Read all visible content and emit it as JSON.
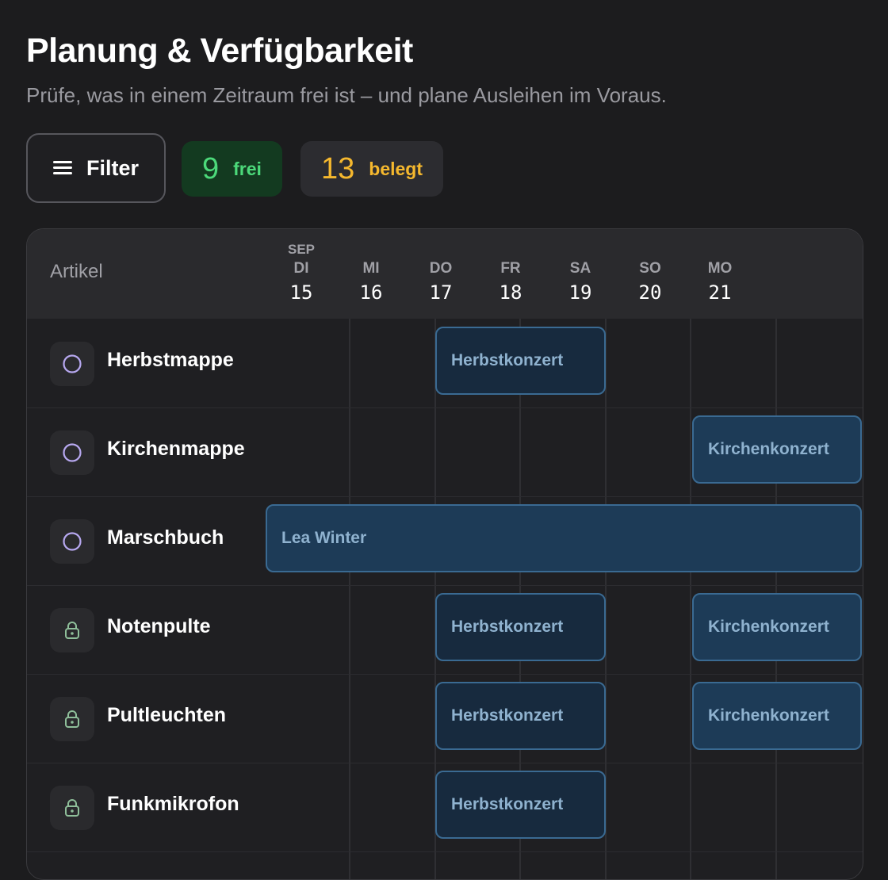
{
  "header": {
    "title": "Planung & Verfügbarkeit",
    "subtitle": "Prüfe, was in einem Zeitraum frei ist – und plane Ausleihen im Voraus."
  },
  "toolbar": {
    "filter_label": "Filter",
    "free_count": "9",
    "free_label": "frei",
    "busy_count": "13",
    "busy_label": "belegt"
  },
  "colors": {
    "accent_free": "#4cd97a",
    "accent_busy": "#f5b82e",
    "booking_border": "#3a6a92",
    "circle_icon": "#b7a8f0",
    "lock_icon": "#8fbf9a"
  },
  "grid": {
    "column_label": "Artikel",
    "month": "SEP",
    "days": [
      {
        "dow": "DI",
        "num": "15"
      },
      {
        "dow": "MI",
        "num": "16"
      },
      {
        "dow": "DO",
        "num": "17"
      },
      {
        "dow": "FR",
        "num": "18"
      },
      {
        "dow": "SA",
        "num": "19"
      },
      {
        "dow": "SO",
        "num": "20"
      },
      {
        "dow": "MO",
        "num": "21"
      }
    ],
    "rows": [
      {
        "name": "Herbstmappe",
        "icon": "circle-icon"
      },
      {
        "name": "Kirchenmappe",
        "icon": "circle-icon"
      },
      {
        "name": "Marschbuch",
        "icon": "circle-icon"
      },
      {
        "name": "Notenpulte",
        "icon": "lock-icon"
      },
      {
        "name": "Pultleuchten",
        "icon": "lock-icon"
      },
      {
        "name": "Funkmikrofon",
        "icon": "lock-icon"
      }
    ],
    "bookings": {
      "herbst": "Herbstkonzert",
      "kirche": "Kirchenkonzert",
      "lea": "Lea Winter"
    }
  }
}
